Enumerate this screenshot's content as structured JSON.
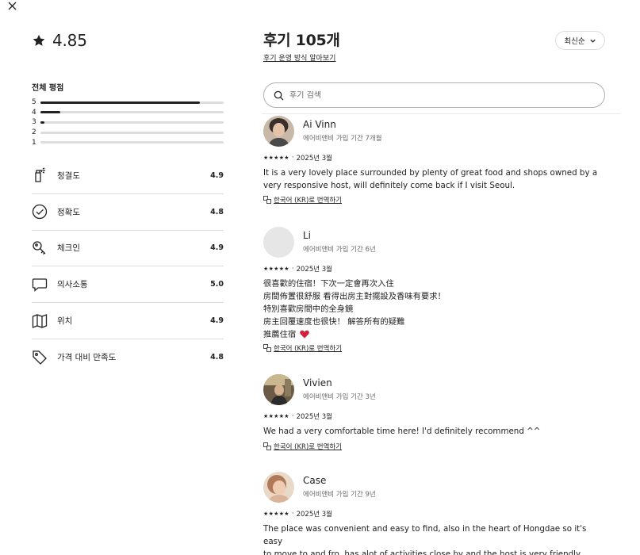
{
  "header": {
    "close_icon": "close-icon"
  },
  "summary": {
    "rating": "4.85",
    "overall_title": "전체 평점",
    "distribution": [
      {
        "label": "5",
        "fraction": 0.87
      },
      {
        "label": "4",
        "fraction": 0.11
      },
      {
        "label": "3",
        "fraction": 0.02
      },
      {
        "label": "2",
        "fraction": 0.0
      },
      {
        "label": "1",
        "fraction": 0.0
      }
    ],
    "categories": [
      {
        "name": "청결도",
        "score": "4.9",
        "icon": "cleaning-spray-icon"
      },
      {
        "name": "정확도",
        "score": "4.8",
        "icon": "check-circle-icon"
      },
      {
        "name": "체크인",
        "score": "4.9",
        "icon": "key-icon"
      },
      {
        "name": "의사소통",
        "score": "5.0",
        "icon": "chat-bubble-icon"
      },
      {
        "name": "위치",
        "score": "4.9",
        "icon": "map-icon"
      },
      {
        "name": "가격 대비 만족도",
        "score": "4.8",
        "icon": "price-tag-icon"
      }
    ]
  },
  "main": {
    "title": "후기 105개",
    "how_link": "후기 운영 방식 알아보기",
    "sort_label": "최신순",
    "search_placeholder": "후기 검색",
    "translate_label": "한국어 (KR)로 번역하기",
    "reviews": [
      {
        "name": "Ai Vinn",
        "sub": "에어비앤비 가입 기간 7개월",
        "stars": "★★★★★",
        "date": "2025년 3월",
        "text": "It is a very lovely place surrounded by plenty of great food and shops owned by a\nvery responsive host, will definitely come back if I visit Seoul."
      },
      {
        "name": "Li",
        "sub": "에어비앤비 가입 기간 6년",
        "stars": "★★★★★",
        "date": "2025년 3월",
        "text": "很喜歡的住宿！下次一定會再次入住\n房間佈置很舒服 看得出房主對擺設及香味有要求！\n特別喜歡房間中的全身鏡\n房主回覆速度也很快！ 解答所有的疑難\n推薦住宿"
      },
      {
        "name": "Vivien",
        "sub": "에어비앤비 가입 기간 3년",
        "stars": "★★★★★",
        "date": "2025년 3월",
        "text": "We had a very comfortable time here! I'd definitely recommend ^^"
      },
      {
        "name": "Case",
        "sub": "에어비앤비 가입 기간 9년",
        "stars": "★★★★★",
        "date": "2025년 3월",
        "text": "The place was convenient and easy to find, also in the heart of Hongdae so it's easy\nto move to and fro, has alot of activities close by and the host is very friendly,\nhelpful and responsive to all our personal questions."
      }
    ]
  }
}
